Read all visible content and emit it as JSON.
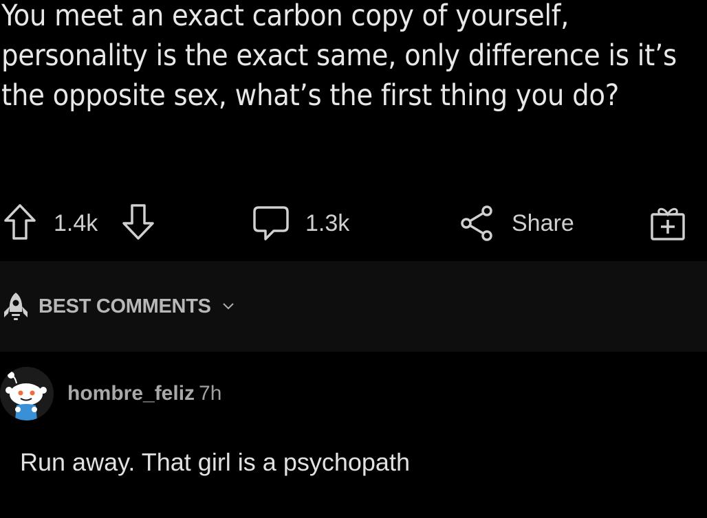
{
  "post": {
    "title": "You meet an exact carbon copy of yourself, personality is the exact same, only difference is it’s the opposite sex, what’s the first thing you do?"
  },
  "actions": {
    "upvote_count": "1.4k",
    "comment_count": "1.3k",
    "share_label": "Share",
    "upvote_icon": "arrow-up-outline",
    "downvote_icon": "arrow-down-outline",
    "comment_icon": "speech-bubble",
    "share_icon": "share-nodes",
    "award_icon": "gift-box"
  },
  "sort": {
    "label": "BEST COMMENTS",
    "icon": "rocket",
    "chevron_icon": "chevron-down"
  },
  "comments": [
    {
      "username": "hombre_feliz",
      "time": "7h",
      "body": "Run away. That girl is a psychopath",
      "avatar": "snoo-avatar"
    }
  ],
  "colors": {
    "background": "#000000",
    "sort_bar_background": "#0e0e0e",
    "primary_text": "#e8e8e8",
    "secondary_text": "#a9a9a9",
    "avatar_accent": "#3a90d6",
    "snoo_eye": "#f26b3a"
  }
}
